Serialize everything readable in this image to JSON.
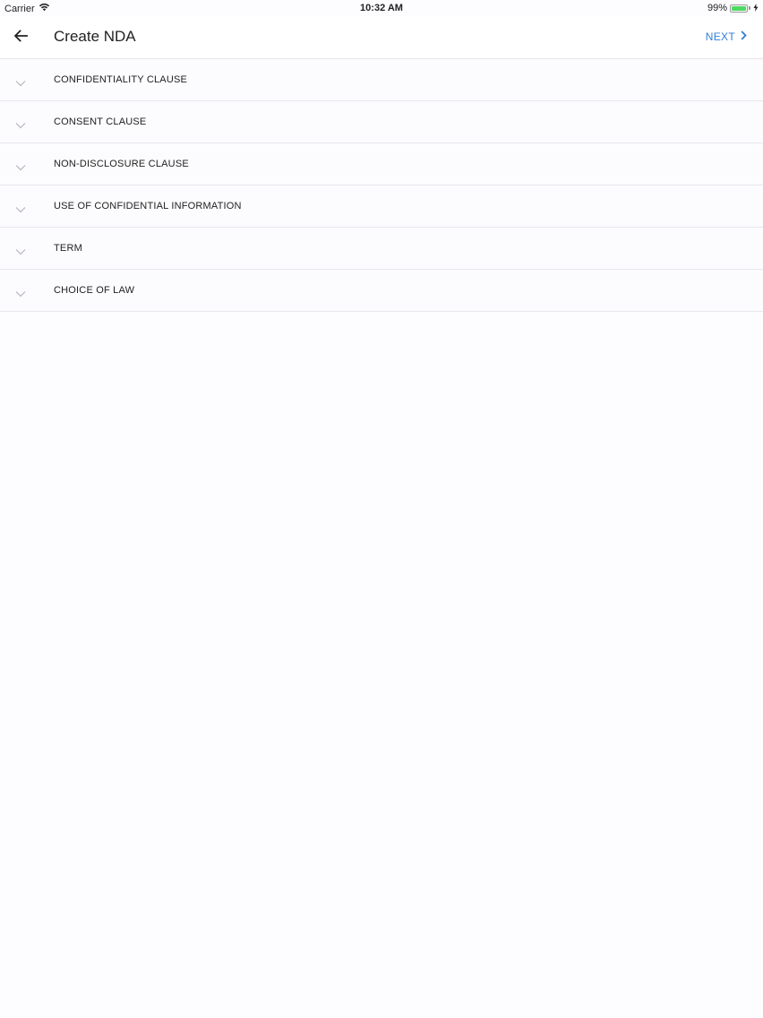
{
  "status_bar": {
    "carrier": "Carrier",
    "time": "10:32 AM",
    "battery_percent_text": "99%",
    "battery_level": 0.99,
    "battery_color": "#4cd964"
  },
  "header": {
    "back_icon": "arrow-left-icon",
    "title": "Create NDA",
    "next_label": "NEXT",
    "next_icon": "chevron-right-icon",
    "accent_color": "#2f7fd8"
  },
  "clauses": [
    {
      "label": "CONFIDENTIALITY CLAUSE",
      "icon": "chevron-down-icon"
    },
    {
      "label": "CONSENT CLAUSE",
      "icon": "chevron-down-icon"
    },
    {
      "label": "NON-DISCLOSURE CLAUSE",
      "icon": "chevron-down-icon"
    },
    {
      "label": "USE OF CONFIDENTIAL INFORMATION",
      "icon": "chevron-down-icon"
    },
    {
      "label": "TERM",
      "icon": "chevron-down-icon"
    },
    {
      "label": "CHOICE OF LAW",
      "icon": "chevron-down-icon"
    }
  ]
}
